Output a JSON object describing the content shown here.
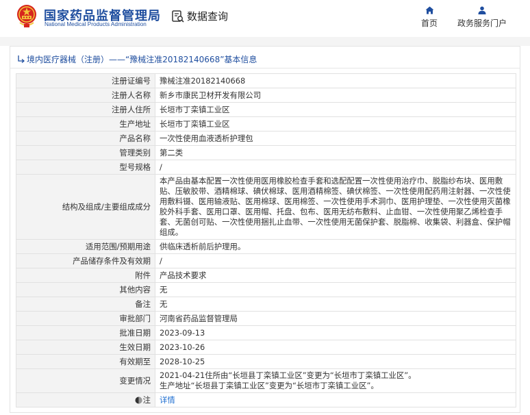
{
  "header": {
    "site_name_cn": "国家药品监督管理局",
    "site_name_en": "National Medical Products Administration",
    "data_query": "数据查询",
    "nav": [
      {
        "label": "首页",
        "icon": "home-icon"
      },
      {
        "label": "政务服务门户",
        "icon": "user-icon"
      }
    ]
  },
  "breadcrumb": "境内医疗器械（注册）——“豫械注准20182140668”基本信息",
  "records": [
    {
      "label": "注册证编号",
      "value": "豫械注准20182140668"
    },
    {
      "label": "注册人名称",
      "value": "新乡市康民卫材开发有限公司"
    },
    {
      "label": "注册人住所",
      "value": "长垣市丁栾镇工业区"
    },
    {
      "label": "生产地址",
      "value": "长垣市丁栾镇工业区"
    },
    {
      "label": "产品名称",
      "value": "一次性使用血液透析护理包"
    },
    {
      "label": "管理类别",
      "value": "第二类"
    },
    {
      "label": "型号规格",
      "value": "/"
    },
    {
      "label": "结构及组成/主要组成成分",
      "value": "本产品由基本配置一次性使用医用橡胶检查手套和选配配置一次性使用治疗巾、脱脂纱布块、医用敷贴、压敏胶带、酒精棉球、碘伏棉球、医用酒精棉签、碘伏棉签、一次性使用配药用注射器、一次性使用敷料镊、医用输液贴、医用棉球、医用棉签、一次性使用手术洞巾、医用护理垫、一次性使用灭菌橡胶外科手套、医用口罩、医用帽、托盘、包布、医用无纺布敷料、止血钳、一次性使用聚乙烯检查手套、无菌创可贴、一次性使用捆扎止血带、一次性使用无菌保护套、脱脂棉、收集袋、利器盒、保护帽组成。"
    },
    {
      "label": "适用范围/预期用途",
      "value": "供临床透析前后护理用。"
    },
    {
      "label": "产品储存条件及有效期",
      "value": "/"
    },
    {
      "label": "附件",
      "value": "产品技术要求"
    },
    {
      "label": "其他内容",
      "value": "无"
    },
    {
      "label": "备注",
      "value": "无"
    },
    {
      "label": "审批部门",
      "value": "河南省药品监督管理局"
    },
    {
      "label": "批准日期",
      "value": "2023-09-13"
    },
    {
      "label": "生效日期",
      "value": "2023-10-26"
    },
    {
      "label": "有效期至",
      "value": "2028-10-25"
    },
    {
      "label": "变更情况",
      "value_lines": [
        "2021-04-21住所由“长垣县丁栾镇工业区”变更为“长垣市丁栾镇工业区”。",
        "生产地址“长垣县丁栾镇工业区”变更为“长垣市丁栾镇工业区”。"
      ]
    },
    {
      "label": "注",
      "value": "详情"
    }
  ],
  "colors": {
    "brand": "#1f4e9f",
    "link": "#1f6fd1",
    "label_bg": "#f3f3f3",
    "border": "#e1e1e1"
  }
}
